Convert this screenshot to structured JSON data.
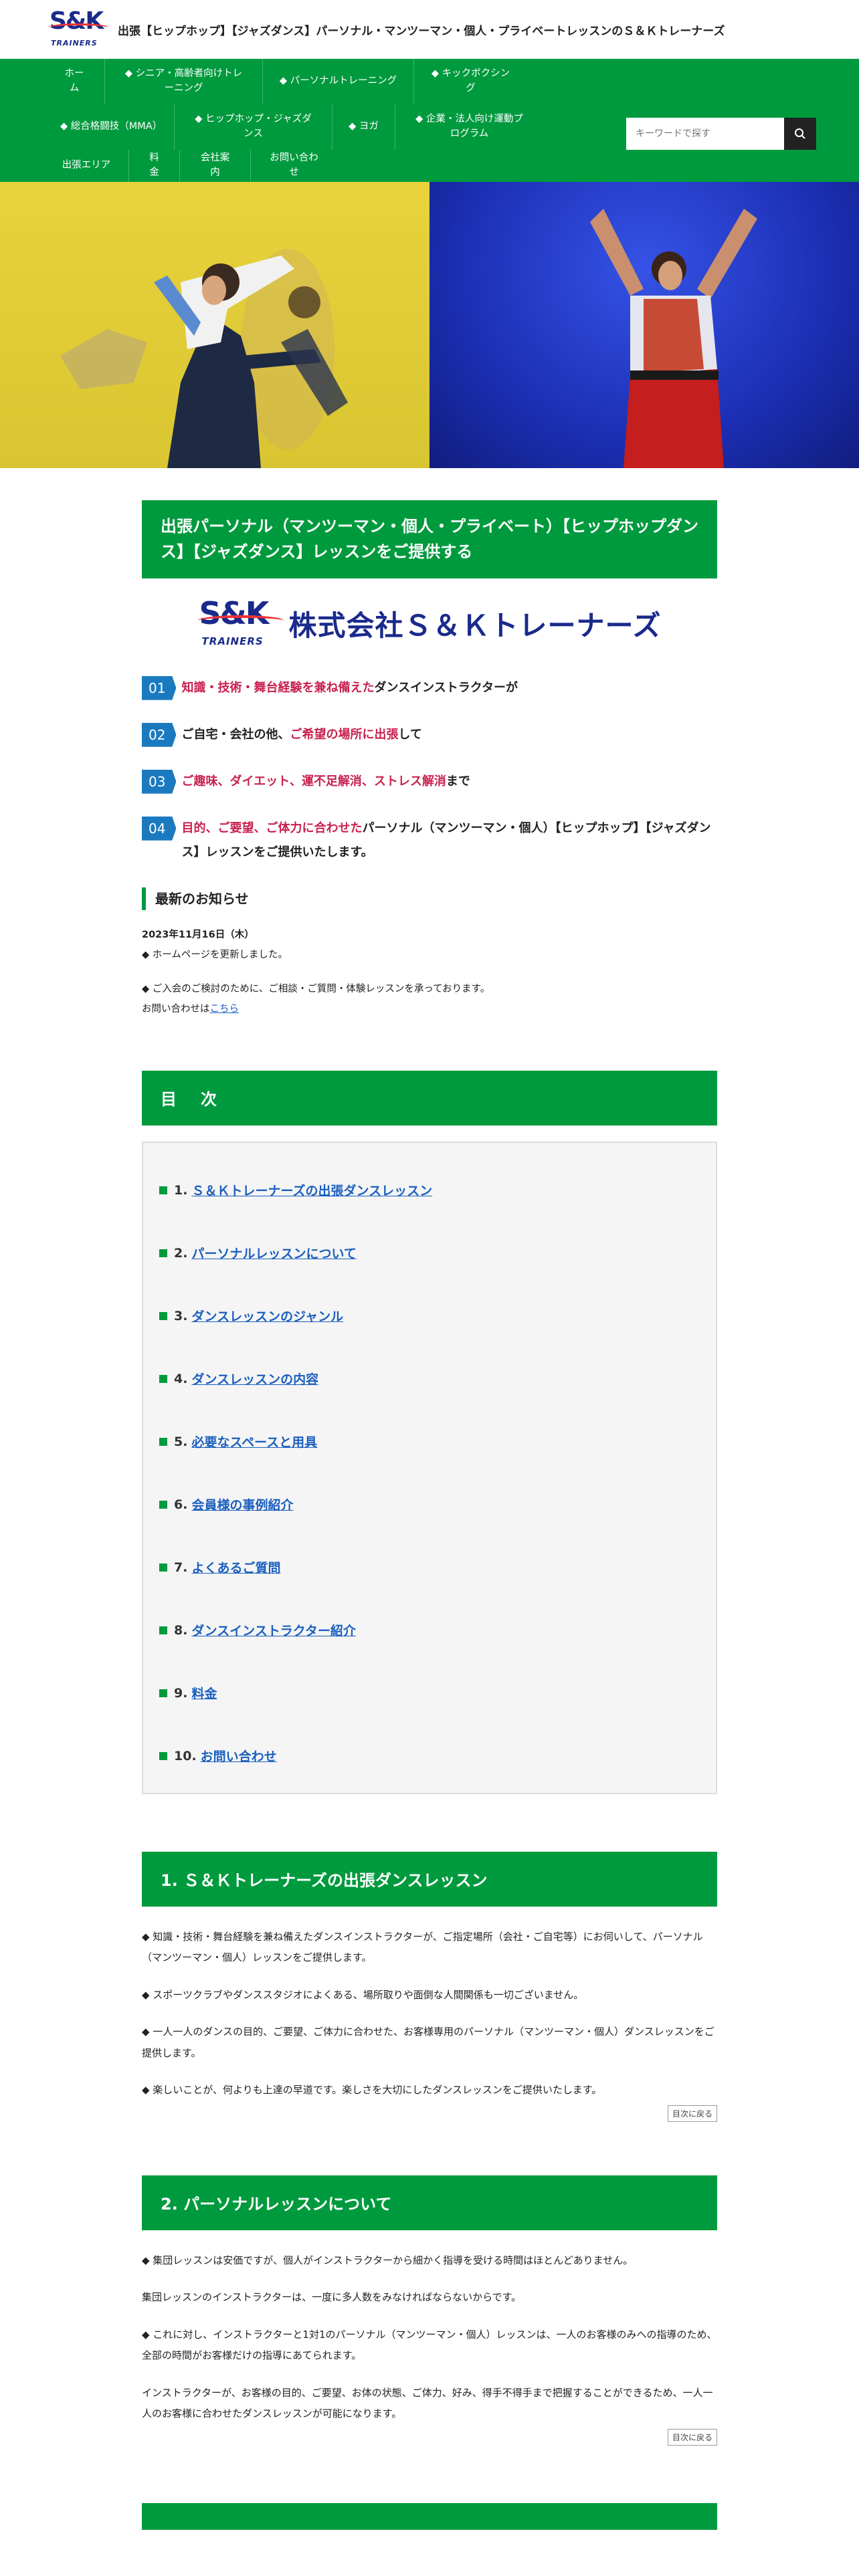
{
  "header": {
    "logo_letters": "S&K",
    "logo_sub": "TRAINERS",
    "site_title": "出張【ヒップホップ】【ジャズダンス】パーソナル・マンツーマン・個人・プライベートレッスンのＳ＆Ｋトレーナーズ"
  },
  "nav": {
    "row1": [
      "ホーム",
      "◆ シニア・高齢者向けトレーニング",
      "◆ パーソナルトレーニング",
      "◆ キックボクシング"
    ],
    "row2": [
      "◆ 総合格闘技（MMA）",
      "◆ ヒップホップ・ジャズダンス",
      "◆ ヨガ",
      "◆ 企業・法人向け運動プログラム"
    ],
    "row3": [
      "出張エリア",
      "料金",
      "会社案内",
      "お問い合わせ"
    ],
    "search_placeholder": "キーワードで探す"
  },
  "main": {
    "page_heading": "出張パーソナル（マンツーマン・個人・プライベート）【ヒップホップダンス】【ジャズダンス】レッスンをご提供する",
    "brand_logo_letters": "S&K",
    "brand_logo_sub": "TRAINERS",
    "company_name": "株式会社Ｓ＆Ｋトレーナーズ",
    "points": [
      {
        "num": "01",
        "hl": "知識・技術・舞台経験を兼ね備えた",
        "rest": "ダンスインストラクターが"
      },
      {
        "num": "02",
        "pre": "ご自宅・会社の他、",
        "hl": "ご希望の場所に出張",
        "rest": "して"
      },
      {
        "num": "03",
        "hl": "ご趣味、ダイエット、運不足解消、ストレス解消",
        "rest": "まで"
      },
      {
        "num": "04",
        "hl": "目的、ご要望、ご体力に合わせた",
        "rest": "パーソナル（マンツーマン・個人）【ヒップホップ】【ジャズダンス】レッスンをご提供いたします。"
      }
    ],
    "news": {
      "heading": "最新のお知らせ",
      "date": "2023年11月16日（木）",
      "line1": "◆ ホームページを更新しました。",
      "line2": "◆ ご入会のご検討のために、ご相談・ご質問・体験レッスンを承っております。",
      "line3_pre": "お問い合わせは",
      "line3_link": "こちら"
    },
    "toc": {
      "heading": "目　次",
      "items": [
        {
          "num": "1.",
          "label": "Ｓ＆Ｋトレーナーズの出張ダンスレッスン"
        },
        {
          "num": "2.",
          "label": "パーソナルレッスンについて"
        },
        {
          "num": "3.",
          "label": "ダンスレッスンのジャンル"
        },
        {
          "num": "4.",
          "label": "ダンスレッスンの内容"
        },
        {
          "num": "5.",
          "label": "必要なスペースと用具"
        },
        {
          "num": "6.",
          "label": "会員様の事例紹介"
        },
        {
          "num": "7.",
          "label": "よくあるご質問"
        },
        {
          "num": "8.",
          "label": "ダンスインストラクター紹介"
        },
        {
          "num": "9.",
          "label": "料金"
        },
        {
          "num": "10.",
          "label": "お問い合わせ"
        }
      ]
    },
    "section1": {
      "heading": "1. Ｓ＆Ｋトレーナーズの出張ダンスレッスン",
      "paragraphs": [
        "◆ 知識・技術・舞台経験を兼ね備えたダンスインストラクターが、ご指定場所（会社・ご自宅等）にお伺いして、パーソナル（マンツーマン・個人）レッスンをご提供します。",
        "◆ スポーツクラブやダンススタジオによくある、場所取りや面倒な人間関係も一切ございません。",
        "◆ 一人一人のダンスの目的、ご要望、ご体力に合わせた、お客様専用のパーソナル（マンツーマン・個人）ダンスレッスンをご提供します。",
        "◆ 楽しいことが、何よりも上達の早道です。楽しさを大切にしたダンスレッスンをご提供いたします。"
      ],
      "back": "目次に戻る"
    },
    "section2": {
      "heading": "2. パーソナルレッスンについて",
      "paragraphs": [
        "◆ 集団レッスンは安価ですが、個人がインストラクターから細かく指導を受ける時間はほとんどありません。",
        "集団レッスンのインストラクターは、一度に多人数をみなければならないからです。",
        "◆ これに対し、インストラクターと1対1のパーソナル（マンツーマン・個人）レッスンは、一人のお客様のみへの指導のため、全部の時間がお客様だけの指導にあてられます。",
        "インストラクターが、お客様の目的、ご要望、お体の状態、ご体力、好み、得手不得手まで把握することができるため、一人一人のお客様に合わせたダンスレッスンが可能になります。"
      ],
      "back": "目次に戻る"
    }
  },
  "colors": {
    "brand_green": "#009a3e",
    "point_blue": "#1b7abf",
    "highlight": "#c8214f",
    "logo_navy": "#1a2a8c"
  }
}
